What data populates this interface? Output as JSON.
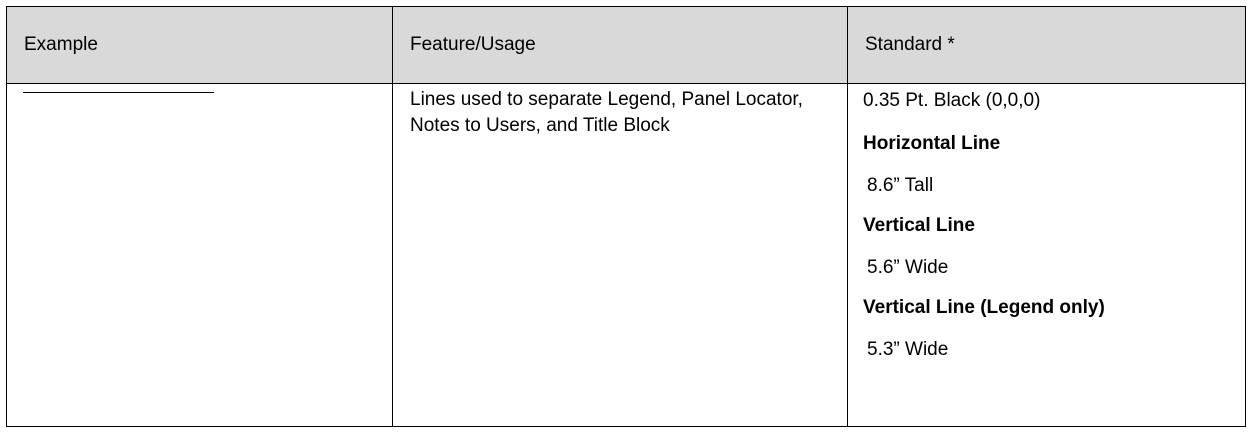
{
  "table": {
    "headers": [
      "Example",
      "Feature/Usage",
      "Standard *"
    ],
    "row": {
      "usage": "Lines used to separate Legend, Panel Locator, Notes to Users, and Title Block",
      "standard": [
        {
          "text": "0.35 Pt. Black (0,0,0)",
          "bold": false
        },
        {
          "text": "Horizontal Line",
          "bold": true
        },
        {
          "text": "8.6” Tall",
          "bold": false
        },
        {
          "text": "Vertical Line",
          "bold": true
        },
        {
          "text": "5.6” Wide",
          "bold": false
        },
        {
          "text": "Vertical Line (Legend only)",
          "bold": true
        },
        {
          "text": "5.3” Wide",
          "bold": false
        }
      ]
    }
  },
  "colors": {
    "header_background": "#d9d9d9",
    "border": "#000000",
    "text": "#000000"
  }
}
